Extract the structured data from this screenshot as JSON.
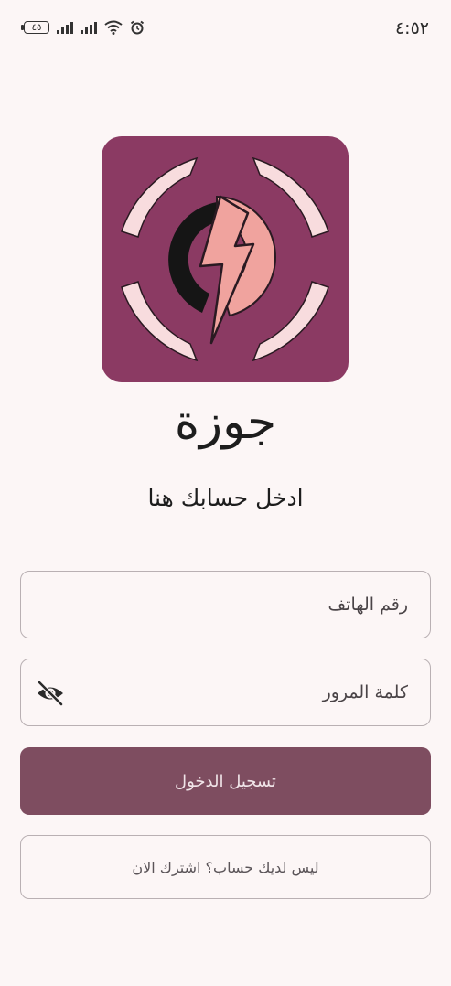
{
  "status_bar": {
    "time": "٤:٥٢",
    "battery_level": "٤٥",
    "icons": [
      "battery-icon",
      "signal-icon",
      "signal-icon",
      "wifi-icon",
      "alarm-icon"
    ]
  },
  "app": {
    "name": "جوزة",
    "subtitle": "ادخل حسابك هنا",
    "logo_icon": "lightning-logo-icon"
  },
  "form": {
    "phone_placeholder": "رقم الهاتف",
    "password_placeholder": "كلمة المرور",
    "password_toggle_icon": "eye-off-icon",
    "login_label": "تسجيل الدخول",
    "signup_label": "ليس لديك حساب؟  اشترك الان"
  },
  "colors": {
    "background": "#fcf6f6",
    "logo_background": "#8b3a63",
    "logo_ring": "#f8dcde",
    "logo_bolt": "#f0a39e",
    "button_primary": "#7e4d60",
    "border": "#b9b0b3"
  }
}
